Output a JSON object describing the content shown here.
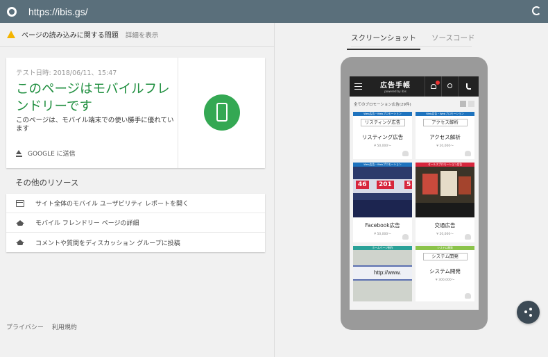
{
  "browser": {
    "url": "https://ibis.gs/",
    "icons": {
      "site": "globe-icon",
      "reload": "reload-icon"
    }
  },
  "warning": {
    "text": "ページの読み込みに関する問題",
    "link": "詳細を表示",
    "icon": "warning-triangle-icon",
    "color": "#f4b400"
  },
  "result": {
    "date": "テスト日時: 2018/06/11、15:47",
    "headline": "このページはモバイルフレンドリーです",
    "description": "このページは、モバイル端末での使い勝手に優れています",
    "send_label": "GOOGLE に送信",
    "badge_icon": "mobile-phone-icon",
    "accent_color": "#1e8e3e"
  },
  "resources": {
    "title": "その他のリソース",
    "items": [
      {
        "label": "サイト全体のモバイル ユーザビリティ レポートを開く",
        "icon": "report-icon"
      },
      {
        "label": "モバイル フレンドリー ページの詳細",
        "icon": "school-icon"
      },
      {
        "label": "コメントや質問をディスカッション グループに投稿",
        "icon": "school-icon"
      }
    ]
  },
  "footer": {
    "privacy": "プライバシー",
    "terms": "利用規約"
  },
  "tabs": [
    {
      "label": "スクリーンショット",
      "active": true
    },
    {
      "label": "ソースコード",
      "active": false
    }
  ],
  "phone": {
    "logo": "広告手帳",
    "powered": "powered by ibis",
    "promo_bar": "全てのプロモーション広告(29件)",
    "tiles": [
      {
        "tag": "Web広告・Webプロモーション",
        "tag_color": "#1e73be",
        "mini": "リスティング広告",
        "name": "リスティング広告",
        "price": "¥ 50,000〜"
      },
      {
        "tag": "Web広告・Webプロモーション",
        "tag_color": "#1e73be",
        "mini": "アクセス解析",
        "name": "アクセス解析",
        "price": "¥ 20,000〜"
      },
      {
        "tag": "Web広告・Webプロモーション",
        "tag_color": "#1e73be",
        "photo_text": [
          "46",
          "201",
          "5"
        ],
        "name": "Facebook広告",
        "price": "¥ 50,000〜"
      },
      {
        "tag": "セールスプロモーション広告",
        "tag_color": "#d7263d",
        "name": "交通広告",
        "price": "¥ 20,000〜"
      },
      {
        "tag": "ホームページ制作",
        "tag_color": "#2aa198",
        "photo_text": [
          "http://www."
        ]
      },
      {
        "tag": "システム開発",
        "tag_color": "#8bc34a",
        "mini": "システム開発",
        "name": "システム開発",
        "price": "¥ 300,000〜"
      }
    ]
  },
  "share": {
    "icon": "share-icon"
  }
}
